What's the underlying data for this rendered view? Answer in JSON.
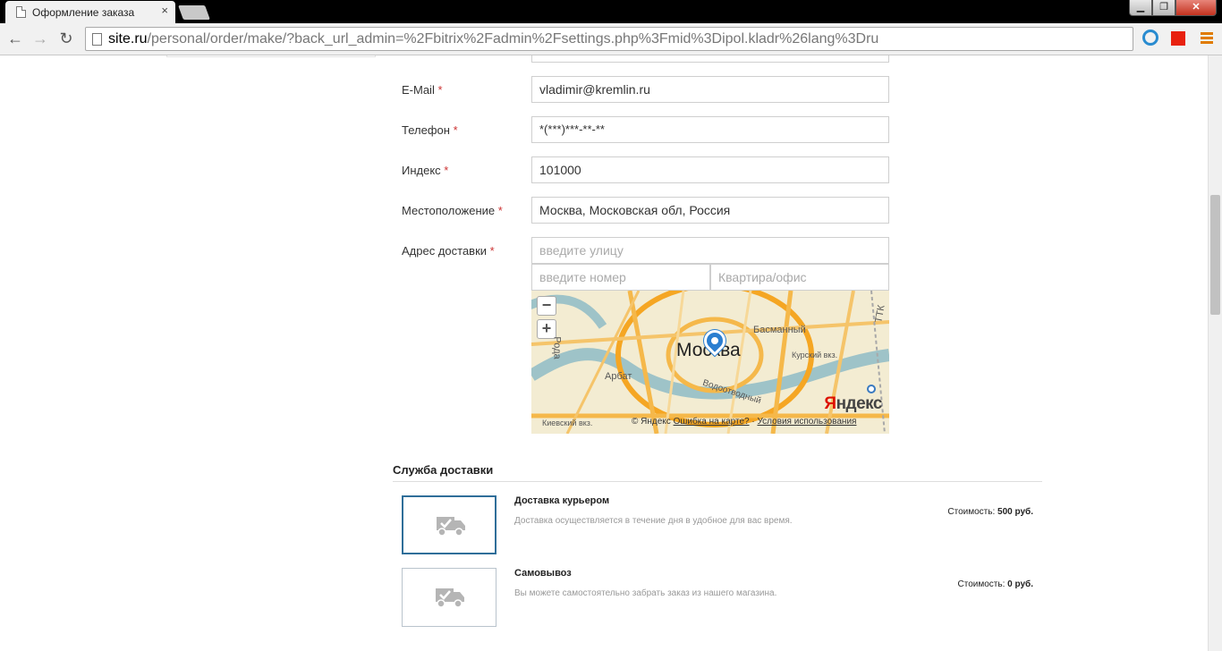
{
  "browser": {
    "tab_title": "Оформление заказа",
    "tab_close": "×",
    "url_domain": "site.ru",
    "url_path": "/personal/order/make/?back_url_admin=%2Fbitrix%2Fadmin%2Fsettings.php%3Fmid%3Dipol.kladr%26lang%3Dru",
    "back_glyph": "←",
    "forward_glyph": "→",
    "reload_glyph": "↻",
    "min_glyph": "▁",
    "max_glyph": "❐",
    "close_glyph": "✕"
  },
  "form": {
    "email": {
      "label": "E-Mail",
      "required": "*",
      "value": "vladimir@kremlin.ru"
    },
    "phone": {
      "label": "Телефон",
      "required": "*",
      "value": "*(***)***-**-**"
    },
    "index": {
      "label": "Индекс",
      "required": "*",
      "value": "101000"
    },
    "location": {
      "label": "Местоположение",
      "required": "*",
      "value": "Москва, Московская обл, Россия"
    },
    "address": {
      "label": "Адрес доставки",
      "required": "*",
      "street_placeholder": "введите улицу",
      "number_placeholder": "введите номер",
      "flat_placeholder": "Квартира/офис"
    }
  },
  "map": {
    "city": "Москва",
    "zoom_out": "−",
    "zoom_in": "+",
    "labels": [
      "Басманный",
      "Курский вкз.",
      "Арбат",
      "Киевский вкз.",
      "Водоотводный",
      "ТТК",
      "Рода"
    ],
    "logo": "Яндекс",
    "copyright": "© Яндекс",
    "error_link": "Ошибка на карте?",
    "separator": "·",
    "terms_link": "Условия использования"
  },
  "delivery": {
    "title": "Служба доставки",
    "price_label": "Стоимость:",
    "options": [
      {
        "name": "Доставка курьером",
        "description": "Доставка осуществляется в течение дня в удобное для вас время.",
        "price": "500 руб.",
        "selected": true
      },
      {
        "name": "Самовывоз",
        "description": "Вы можете самостоятельно забрать заказ из нашего магазина.",
        "price": "0 руб.",
        "selected": false
      }
    ]
  },
  "colors": {
    "accent": "#2f6e99",
    "required": "#cc3333",
    "map_pin": "#2a7ed0"
  }
}
